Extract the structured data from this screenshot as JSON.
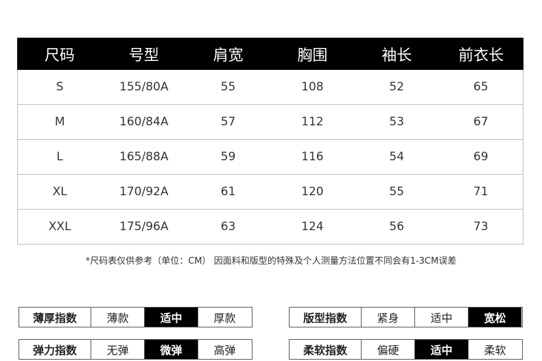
{
  "size_table": {
    "headers": [
      "尺码",
      "号型",
      "肩宽",
      "胸围",
      "袖长",
      "前衣长"
    ],
    "rows": [
      [
        "S",
        "155/80A",
        "55",
        "108",
        "52",
        "65"
      ],
      [
        "M",
        "160/84A",
        "57",
        "112",
        "53",
        "67"
      ],
      [
        "L",
        "165/88A",
        "59",
        "116",
        "54",
        "69"
      ],
      [
        "XL",
        "170/92A",
        "61",
        "120",
        "55",
        "71"
      ],
      [
        "XXL",
        "175/96A",
        "63",
        "124",
        "56",
        "73"
      ]
    ]
  },
  "note": "*尺码表仅供参考（单位：CM） 因面料和版型的特殊及个人测量方法位置不同会有1-3CM误差",
  "indices": {
    "thickness": {
      "label": "薄厚指数",
      "options": [
        "薄款",
        "适中",
        "厚款"
      ],
      "selected": "适中"
    },
    "fit": {
      "label": "版型指数",
      "options": [
        "紧身",
        "适中",
        "宽松"
      ],
      "selected": "宽松"
    },
    "elasticity": {
      "label": "弹力指数",
      "options": [
        "无弹",
        "微弹",
        "高弹"
      ],
      "selected": "微弹"
    },
    "softness": {
      "label": "柔软指数",
      "options": [
        "偏硬",
        "适中",
        "柔软"
      ],
      "selected": "适中"
    }
  },
  "colors": {
    "header_bg": "#000000",
    "header_text": "#ffffff",
    "selected_bg": "#000000",
    "selected_text": "#ffffff",
    "row_border": "#bdbdbd"
  }
}
